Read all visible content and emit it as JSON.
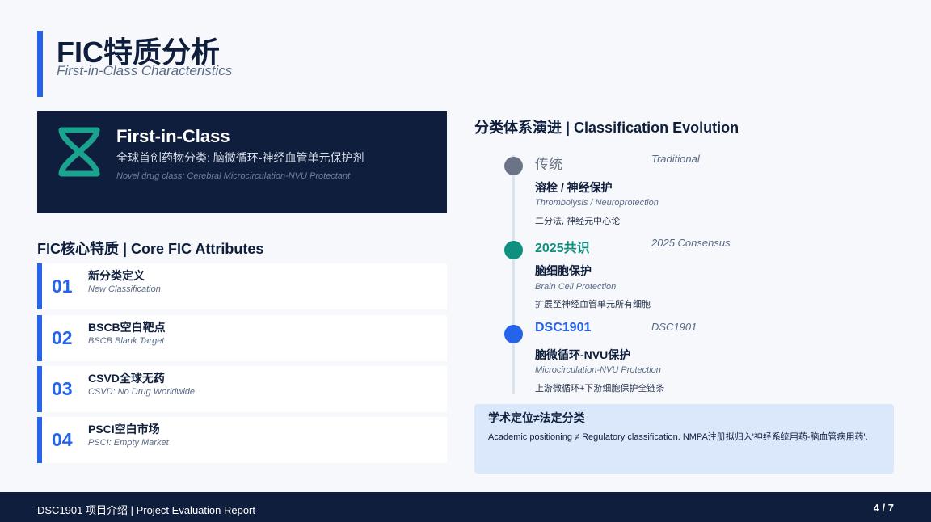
{
  "header": {
    "title": "FIC特质分析",
    "subtitle": "First-in-Class Characteristics"
  },
  "hero": {
    "icon": "dna-icon",
    "title": "First-in-Class",
    "cn": "全球首创药物分类: 脑微循环-神经血管单元保护剂",
    "en": "Novel drug class: Cerebral Microcirculation-NVU Protectant"
  },
  "attributes": {
    "title": "FIC核心特质 | Core FIC Attributes",
    "items": [
      {
        "num": "01",
        "cn": "新分类定义",
        "en": "New Classification"
      },
      {
        "num": "02",
        "cn": "BSCB空白靶点",
        "en": "BSCB Blank Target"
      },
      {
        "num": "03",
        "cn": "CSVD全球无药",
        "en": "CSVD: No Drug Worldwide"
      },
      {
        "num": "04",
        "cn": "PSCI空白市场",
        "en": "PSCI: Empty Market"
      }
    ]
  },
  "evolution": {
    "title": "分类体系演进 | Classification Evolution",
    "stages": [
      {
        "label": "传统",
        "tag": "Traditional",
        "head": "溶栓 / 神经保护",
        "en": "Thrombolysis / Neuroprotection",
        "desc": "二分法, 神经元中心论",
        "color": "#6b7487"
      },
      {
        "label": "2025共识",
        "tag": "2025 Consensus",
        "head": "脑细胞保护",
        "en": "Brain Cell Protection",
        "desc": "扩展至神经血管单元所有细胞",
        "color": "#0f8f7e"
      },
      {
        "label": "DSC1901",
        "tag": "DSC1901",
        "head": "脑微循环-NVU保护",
        "en": "Microcirculation-NVU Protection",
        "desc": "上游微循环+下游细胞保护全链条",
        "color": "#2563eb"
      }
    ]
  },
  "note": {
    "title": "学术定位≠法定分类",
    "text": "Academic positioning ≠ Regulatory classification. NMPA注册拟归入'神经系统用药-脑血管病用药'."
  },
  "footer": {
    "left": "DSC1901 项目介绍 | Project Evaluation Report",
    "page": "4 / 7"
  }
}
